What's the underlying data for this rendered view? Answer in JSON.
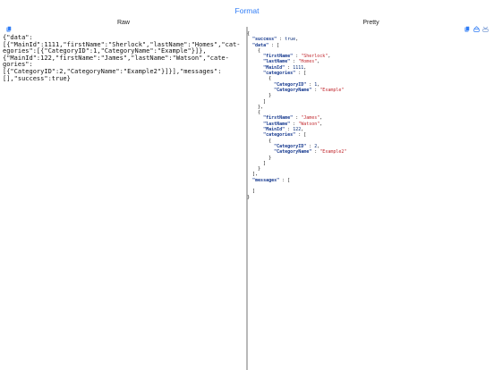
{
  "toolbar": {
    "format_label": "Format"
  },
  "raw_pane": {
    "title": "Raw",
    "copy_icon": "clipboard-icon",
    "lines": [
      "{\"data\":",
      "[{\"MainId\":1111,\"firstName\":\"Sherlock\",\"lastName\":\"Homes\",\"cat-",
      "egories\":[{\"CategoryID\":1,\"CategoryName\":\"Example\"}]},",
      "{\"MainId\":122,\"firstName\":\"James\",\"lastName\":\"Watson\",\"cate-",
      "gories\":",
      "[{\"CategoryID\":2,\"CategoryName\":\"Example2\"}]}],\"messages\":",
      "[],\"success\":true}"
    ]
  },
  "pretty_pane": {
    "title": "Pretty",
    "icons": [
      "clipboard-icon",
      "collapse-icon",
      "expand-icon"
    ],
    "lines": [
      [
        {
          "t": "p",
          "v": "{"
        }
      ],
      [
        {
          "t": "p",
          "v": "  "
        },
        {
          "t": "k",
          "v": "\"success\""
        },
        {
          "t": "p",
          "v": " : "
        },
        {
          "t": "b",
          "v": "true"
        },
        {
          "t": "p",
          "v": ","
        }
      ],
      [
        {
          "t": "p",
          "v": "  "
        },
        {
          "t": "k",
          "v": "\"data\""
        },
        {
          "t": "p",
          "v": " : ["
        }
      ],
      [
        {
          "t": "p",
          "v": "    {"
        }
      ],
      [
        {
          "t": "p",
          "v": "      "
        },
        {
          "t": "k",
          "v": "\"firstName\""
        },
        {
          "t": "p",
          "v": " : "
        },
        {
          "t": "s",
          "v": "\"Sherlock\""
        },
        {
          "t": "p",
          "v": ","
        }
      ],
      [
        {
          "t": "p",
          "v": "      "
        },
        {
          "t": "k",
          "v": "\"lastName\""
        },
        {
          "t": "p",
          "v": " : "
        },
        {
          "t": "s",
          "v": "\"Homes\""
        },
        {
          "t": "p",
          "v": ","
        }
      ],
      [
        {
          "t": "p",
          "v": "      "
        },
        {
          "t": "k",
          "v": "\"MainId\""
        },
        {
          "t": "p",
          "v": " : "
        },
        {
          "t": "n",
          "v": "1111"
        },
        {
          "t": "p",
          "v": ","
        }
      ],
      [
        {
          "t": "p",
          "v": "      "
        },
        {
          "t": "k",
          "v": "\"categories\""
        },
        {
          "t": "p",
          "v": " : ["
        }
      ],
      [
        {
          "t": "p",
          "v": "        {"
        }
      ],
      [
        {
          "t": "p",
          "v": "          "
        },
        {
          "t": "k",
          "v": "\"CategoryID\""
        },
        {
          "t": "p",
          "v": " : "
        },
        {
          "t": "n",
          "v": "1"
        },
        {
          "t": "p",
          "v": ","
        }
      ],
      [
        {
          "t": "p",
          "v": "          "
        },
        {
          "t": "k",
          "v": "\"CategoryName\""
        },
        {
          "t": "p",
          "v": " : "
        },
        {
          "t": "s",
          "v": "\"Example\""
        }
      ],
      [
        {
          "t": "p",
          "v": "        }"
        }
      ],
      [
        {
          "t": "p",
          "v": "      ]"
        }
      ],
      [
        {
          "t": "p",
          "v": "    },"
        }
      ],
      [
        {
          "t": "p",
          "v": "    {"
        }
      ],
      [
        {
          "t": "p",
          "v": "      "
        },
        {
          "t": "k",
          "v": "\"firstName\""
        },
        {
          "t": "p",
          "v": " : "
        },
        {
          "t": "s",
          "v": "\"James\""
        },
        {
          "t": "p",
          "v": ","
        }
      ],
      [
        {
          "t": "p",
          "v": "      "
        },
        {
          "t": "k",
          "v": "\"lastName\""
        },
        {
          "t": "p",
          "v": " : "
        },
        {
          "t": "s",
          "v": "\"Watson\""
        },
        {
          "t": "p",
          "v": ","
        }
      ],
      [
        {
          "t": "p",
          "v": "      "
        },
        {
          "t": "k",
          "v": "\"MainId\""
        },
        {
          "t": "p",
          "v": " : "
        },
        {
          "t": "n",
          "v": "122"
        },
        {
          "t": "p",
          "v": ","
        }
      ],
      [
        {
          "t": "p",
          "v": "      "
        },
        {
          "t": "k",
          "v": "\"categories\""
        },
        {
          "t": "p",
          "v": " : ["
        }
      ],
      [
        {
          "t": "p",
          "v": "        {"
        }
      ],
      [
        {
          "t": "p",
          "v": "          "
        },
        {
          "t": "k",
          "v": "\"CategoryID\""
        },
        {
          "t": "p",
          "v": " : "
        },
        {
          "t": "n",
          "v": "2"
        },
        {
          "t": "p",
          "v": ","
        }
      ],
      [
        {
          "t": "p",
          "v": "          "
        },
        {
          "t": "k",
          "v": "\"CategoryName\""
        },
        {
          "t": "p",
          "v": " : "
        },
        {
          "t": "s",
          "v": "\"Example2\""
        }
      ],
      [
        {
          "t": "p",
          "v": "        }"
        }
      ],
      [
        {
          "t": "p",
          "v": "      ]"
        }
      ],
      [
        {
          "t": "p",
          "v": "    }"
        }
      ],
      [
        {
          "t": "p",
          "v": "  ],"
        }
      ],
      [
        {
          "t": "p",
          "v": "  "
        },
        {
          "t": "k",
          "v": "\"messages\""
        },
        {
          "t": "p",
          "v": " : ["
        }
      ],
      [
        {
          "t": "p",
          "v": ""
        }
      ],
      [
        {
          "t": "p",
          "v": "  ]"
        }
      ],
      [
        {
          "t": "p",
          "v": "}"
        }
      ]
    ]
  },
  "colors": {
    "accent": "#2f7cf6",
    "json_key": "#173a8f",
    "json_string": "#c1272d",
    "json_number": "#0b2f7a",
    "divider": "#b9b9b9"
  }
}
